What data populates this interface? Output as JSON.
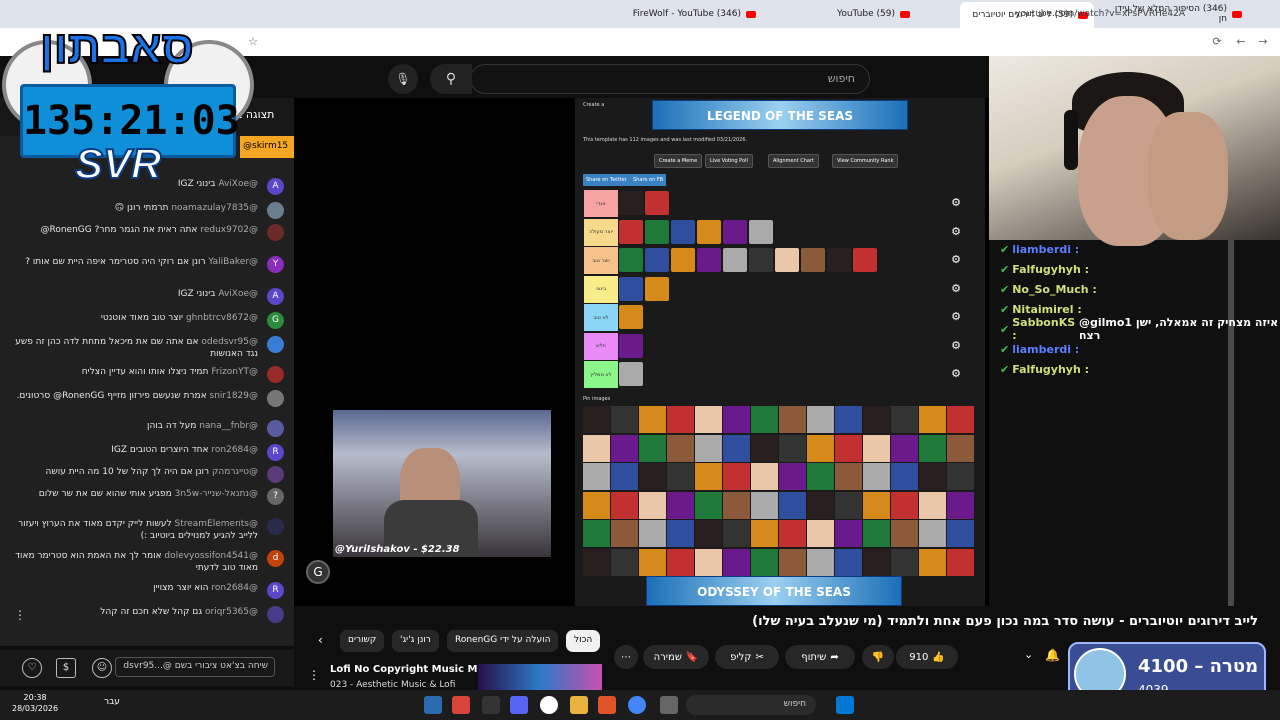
{
  "browser": {
    "tabs": [
      {
        "label": "(346) FireWolf - YouTube",
        "active": false
      },
      {
        "label": "(59) YouTube",
        "active": false
      },
      {
        "label": "(59) לייב דירוגים יוטיוברים",
        "active": true
      },
      {
        "label": "(346) הסיפור המלא של עידן חן",
        "active": false
      }
    ],
    "url": "youtube.com/watch?v=xPsPVRHe42A"
  },
  "overlay": {
    "timer": "135:21:03",
    "logo": "SVR",
    "brand": "סאבתון"
  },
  "youtube": {
    "search_placeholder": "חיפוש",
    "video_title": "לייב דירוגים יוטיוברים - עושה סדר במה נכון פעם אחת ולתמיד (מי שנעלב בעיה שלו)",
    "actions": {
      "like": "910",
      "share": "שיתוף",
      "clip": "קליפ",
      "save": "שמירה"
    },
    "chips": [
      "הכול",
      "הועלה על ידי RonenGG",
      "רונן ג'יג'",
      "קשורים"
    ],
    "music_title": "Lofi No Copyright Music Mix",
    "music_sub": "023 - Aesthetic Music & Lofi"
  },
  "chat": {
    "header_title": "תצוגה ב",
    "pinned_user": "@skirm15",
    "messages": [
      {
        "user": "@AviXoe",
        "text": "בינוני IGZ",
        "color": "#5c46c9",
        "initial": "A"
      },
      {
        "user": "@noamazulay7835",
        "text": "תרמתי רונן 🙃",
        "color": "#6a7e90",
        "initial": ""
      },
      {
        "user": "@redux9702",
        "text": "אתה ראית את הגמר מחר? RonenGG@",
        "color": "#6a2a2a",
        "initial": ""
      },
      {
        "user": "@YaliBaker",
        "text": "רונן אם רוקי היה סטרימר איפה היית שם אותו ?",
        "color": "#8a2db8",
        "initial": "Y"
      },
      {
        "user": "@AviXoe",
        "text": "בינוני IGZ",
        "color": "#5c46c9",
        "initial": "A"
      },
      {
        "user": "@ghnbtrcv8672",
        "text": "יוצר טוב מאוד אוטנטי",
        "color": "#2e8b3e",
        "initial": "G"
      },
      {
        "user": "@odedsvr95",
        "text": "אם אתה שם את מיכאל מתחת לדה כהן זה פשע נגד האנושות",
        "color": "#3a7bd5",
        "initial": ""
      },
      {
        "user": "@FrizonYT",
        "text": "תמיד ניצלו אותו והוא עדיין הצליח",
        "color": "#9a2a2a",
        "initial": ""
      },
      {
        "user": "@snir1829",
        "text": "אמרת שנעשם פירזון מזייף RonenGG@ סרטונים.",
        "color": "#777",
        "initial": ""
      },
      {
        "user": "@nana__fnbr",
        "text": "מעל דה בוהן",
        "color": "#5a5aa0",
        "initial": ""
      },
      {
        "user": "@ron2684",
        "text": "אחד היוצרים הטובים IGZ",
        "color": "#5c46c9",
        "initial": "R"
      },
      {
        "user": "@טייגרמהק",
        "text": "רונן אם היה לך קהל של 10 מה היית עושה",
        "color": "#5a3a7a",
        "initial": ""
      },
      {
        "user": "@נתנאל-שנייר-3n5w",
        "text": "מפגיע אותי שהוא שם את שר שלום",
        "color": "#666",
        "initial": "?"
      },
      {
        "user": "@StreamElements",
        "text": "לעשות לייק יקדם מאוד את הערוץ ויעזור ללייב להגיע למנוילים ביוטיוב :)",
        "color": "#2a2a4a",
        "initial": ""
      },
      {
        "user": "@dolevyossifon4541",
        "text": "אומר לך את האמת הוא סטרימר מאוד מאוד טוב לדעתי",
        "color": "#c2410c",
        "initial": "d"
      },
      {
        "user": "@ron2684",
        "text": "הוא יוצר מצויין",
        "color": "#5c46c9",
        "initial": "R"
      },
      {
        "user": "@oriqr5365",
        "text": "גם קהל שלא חכם זה קהל",
        "color": "#4a3a8a",
        "initial": ""
      }
    ],
    "input_placeholder": "שיחה בצ'אט ציבורי בשם @...dsvr95"
  },
  "tierlist": {
    "info": "This template has 112 images and was last modified 03/21/2026.",
    "create_line": "Create a",
    "buttons": [
      "Create a Meme",
      "Live Voting Poll",
      "Alignment Chart",
      "View Community Rank"
    ],
    "share": [
      "Share on Twitter",
      "Share on FB"
    ],
    "tiers": [
      {
        "label": "אגדי",
        "color": "#f5a3a3",
        "count": 2
      },
      {
        "label": "יוצר מעולה",
        "color": "#f7d98b",
        "count": 6
      },
      {
        "label": "יוצר טוב",
        "color": "#f7c18b",
        "count": 10
      },
      {
        "label": "בינוני",
        "color": "#f7ee8b",
        "count": 2
      },
      {
        "label": "לא טוב",
        "color": "#8bd6f7",
        "count": 1
      },
      {
        "label": "חלש",
        "color": "#e88bf7",
        "count": 1
      },
      {
        "label": "לא ממליץ",
        "color": "#8bf78b",
        "count": 1
      }
    ],
    "pin_images_label": "Pin images",
    "ad_top": "LEGEND OF THE SEAS",
    "ad_bottom": "ODYSSEY OF THE SEAS",
    "webcam_caption": "@YuriIshakov - $22.38"
  },
  "right_chat": [
    {
      "user": "liamberdi",
      "text": "",
      "color": "#5b7fff"
    },
    {
      "user": "Falfugyhyh",
      "text": "",
      "color": "#cfe07a"
    },
    {
      "user": "No_So_Much",
      "text": "",
      "color": "#cfe07a"
    },
    {
      "user": "Nitaimirel",
      "text": "",
      "color": "#cfe07a"
    },
    {
      "user": "SabbonKS",
      "text": "@gilmo1 איזה מצחיק זה אמאלה, ישן רצח",
      "color": "#cfe07a"
    },
    {
      "user": "liamberdi",
      "text": "",
      "color": "#5b7fff"
    },
    {
      "user": "Falfugyhyh",
      "text": "",
      "color": "#cfe07a"
    }
  ],
  "goal": {
    "label": "מטרה",
    "value": "4100",
    "current": "4039"
  },
  "taskbar": {
    "time": "20:38",
    "date": "28/03/2026",
    "search": "חיפוש",
    "lang": "עבר"
  }
}
